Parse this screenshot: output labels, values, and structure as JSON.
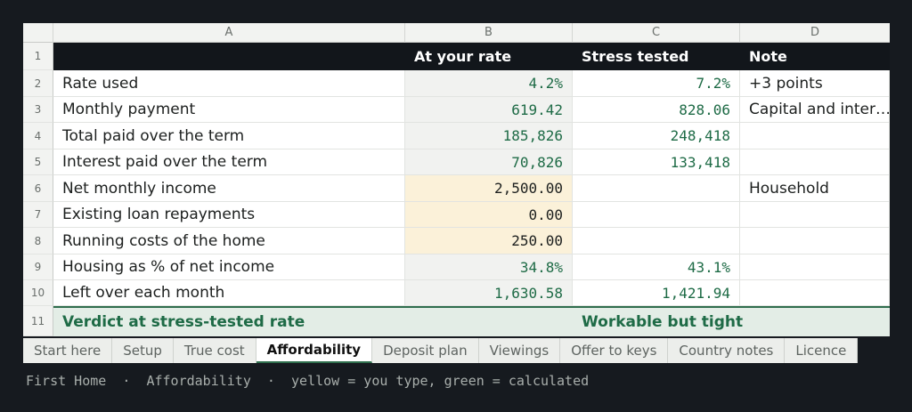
{
  "columns": [
    "A",
    "B",
    "C",
    "D"
  ],
  "row_numbers": [
    "1",
    "2",
    "3",
    "4",
    "5",
    "6",
    "7",
    "8",
    "9",
    "10",
    "11"
  ],
  "header": {
    "a": "",
    "b": "At your rate",
    "c": "Stress tested",
    "d": "Note"
  },
  "rows": [
    {
      "label": "Rate used",
      "b": "4.2%",
      "c": "7.2%",
      "note": "+3 points"
    },
    {
      "label": "Monthly payment",
      "b": "619.42",
      "c": "828.06",
      "note": "Capital and inter…"
    },
    {
      "label": "Total paid over the term",
      "b": "185,826",
      "c": "248,418",
      "note": ""
    },
    {
      "label": "Interest paid over the term",
      "b": "70,826",
      "c": "133,418",
      "note": ""
    },
    {
      "label": "Net monthly income",
      "b": "2,500.00",
      "c": "",
      "note": "Household"
    },
    {
      "label": "Existing loan repayments",
      "b": "0.00",
      "c": "",
      "note": ""
    },
    {
      "label": "Running costs of the home",
      "b": "250.00",
      "c": "",
      "note": ""
    },
    {
      "label": "Housing as % of net income",
      "b": "34.8%",
      "c": "43.1%",
      "note": ""
    },
    {
      "label": "Left over each month",
      "b": "1,630.58",
      "c": "1,421.94",
      "note": ""
    }
  ],
  "verdict": {
    "label": "Verdict at stress-tested rate",
    "value": "Workable but tight"
  },
  "tabs": [
    "Start here",
    "Setup",
    "True cost",
    "Affordability",
    "Deposit plan",
    "Viewings",
    "Offer to keys",
    "Country notes",
    "Licence"
  ],
  "active_tab": "Affordability",
  "status_bar": "First Home  ·  Affordability  ·  yellow = you type, green = calculated",
  "colors": {
    "input_fill": "#fbf1d9",
    "calculated_text": "#1e6b46",
    "header_fill": "#12161b",
    "verdict_fill": "#e3ede6"
  }
}
